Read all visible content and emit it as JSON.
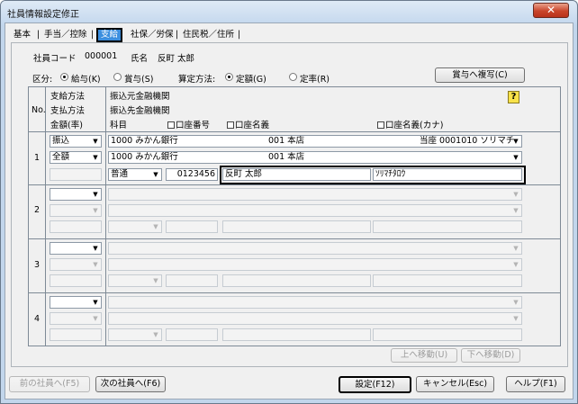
{
  "window": {
    "title": "社員情報設定修正",
    "close": "✕"
  },
  "tabs": [
    {
      "label": "基本"
    },
    {
      "label": "手当／控除"
    },
    {
      "label": "支給"
    },
    {
      "label": "社保／労保"
    },
    {
      "label": "住民税／住所"
    }
  ],
  "tab_separator": "|",
  "employee": {
    "code_label": "社員コード",
    "code": "000001",
    "name_label": "氏名",
    "name": "反町 太郎"
  },
  "kubun": {
    "label": "区分:",
    "opt1": "給与(K)",
    "opt2": "賞与(S)"
  },
  "calc": {
    "label": "算定方法:",
    "opt1": "定額(G)",
    "opt2": "定率(R)"
  },
  "copy_btn": "賞与へ複写(C)",
  "header": {
    "no": "No.",
    "col1": [
      "支給方法",
      "支払方法",
      "金額(率)"
    ],
    "col2a": "振込元金融機関",
    "col2b": "振込先金融機関",
    "kamoku": "科目",
    "zabango": "口座番号",
    "zameigi": "口座名義",
    "zameigi_kana": "口座名義(カナ)"
  },
  "rows": [
    {
      "no": "1",
      "method": "振込",
      "pay": "全額",
      "src_bank": "1000 みかん銀行",
      "src_branch": "001 本店",
      "src_acct": "当座 0001010 ソリマチ",
      "dst_bank": "1000 みかん銀行",
      "dst_branch": "001 本店",
      "kamoku": "普通",
      "acct_no": "0123456",
      "holder": "反町 太郎",
      "holder_kana": "ｿﾘﾏﾁﾀﾛｳ"
    },
    {
      "no": "2"
    },
    {
      "no": "3"
    },
    {
      "no": "4"
    }
  ],
  "move_up": "上へ移動(U)",
  "move_down": "下へ移動(D)",
  "footer": {
    "prev": "前の社員へ(F5)",
    "next": "次の社員へ(F6)",
    "ok": "設定(F12)",
    "cancel": "キャンセル(Esc)",
    "help": "ヘルプ(F1)"
  }
}
